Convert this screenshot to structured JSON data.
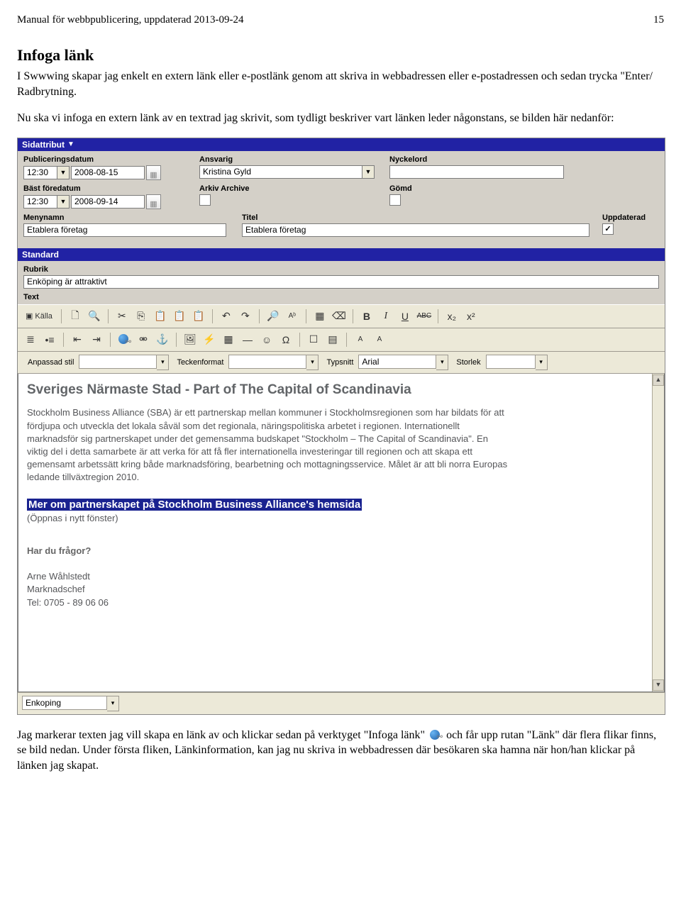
{
  "header": {
    "left": "Manual för webbpublicering, uppdaterad 2013-09-24",
    "right": "15"
  },
  "section": {
    "title": "Infoga länk",
    "para1": "I Swwwing skapar jag enkelt en extern länk eller e-postlänk genom att skriva in webbadressen eller e-postadressen och sedan trycka \"Enter/  Radbrytning.",
    "para2": "Nu ska vi infoga en extern länk av en textrad jag skrivit, som tydligt beskriver vart länken leder någonstans, se bilden här nedanför:",
    "para3_a": "Jag markerar texten jag vill skapa en länk av och klickar sedan på verktyget \"Infoga länk\" ",
    "para3_b": " och får upp rutan \"Länk\" där flera flikar finns, se bild nedan. Under första fliken, Länkinformation, kan jag nu skriva in webbadressen där besökaren ska hamna när hon/han klickar på länken jag skapat."
  },
  "panels": {
    "sidattribut": "Sidattribut",
    "standard": "Standard"
  },
  "attrs": {
    "pubdate_label": "Publiceringsdatum",
    "pubdate_time": "12:30",
    "pubdate_date": "2008-08-15",
    "bastfore_label": "Bäst föredatum ",
    "bastfore_time": "12:30",
    "bastfore_date": "2008-09-14",
    "ansvarig_label": "Ansvarig",
    "ansvarig_value": "Kristina Gyld",
    "arkiv_label": "Arkiv Archive",
    "nyckel_label": "Nyckelord",
    "nyckel_value": "",
    "gomd_label": "Gömd",
    "meny_label": "Menynamn",
    "meny_value": "Etablera företag",
    "titel_label": "Titel",
    "titel_value": "Etablera företag",
    "uppdaterad_label": "Uppdaterad",
    "uppdaterad_checked": "✓"
  },
  "standard": {
    "rubrik_label": "Rubrik",
    "rubrik_value": "Enköping är attraktivt",
    "text_label": "Text"
  },
  "toolbar": {
    "kalla": "Källa",
    "style_label": "Anpassad stil",
    "charfmt_label": "Teckenformat",
    "font_label": "Typsnitt",
    "font_value": "Arial",
    "size_label": "Storlek"
  },
  "editor": {
    "heading": "Sveriges Närmaste Stad - Part of The Capital of Scandinavia",
    "body_p1": "Stockholm Business Alliance (SBA) är ett partnerskap mellan kommuner i Stockholmsregionen som har bildats för att fördjupa och utveckla det lokala såväl som det regionala, näringspolitiska arbetet i regionen. Internationellt marknadsför sig partnerskapet under det gemensamma budskapet \"Stockholm – The Capital of Scandinavia\". En viktig del i detta samarbete är att verka för att få fler internationella investeringar till regionen och att skapa ett gemensamt arbetssätt kring både marknadsföring, bearbetning och mottagningsservice. Målet är att bli norra Europas ledande tillväxtregion 2010.",
    "highlight": "Mer om partnerskapet på Stockholm Business Alliance's hemsida",
    "note": "(Öppnas i nytt fönster)",
    "q": "Har du frågor?",
    "contact_name": "Arne Wåhlstedt",
    "contact_role": "Marknadschef",
    "contact_tel": "Tel: 0705 - 89 06 06"
  },
  "bottom": {
    "tag_value": "Enkoping"
  }
}
